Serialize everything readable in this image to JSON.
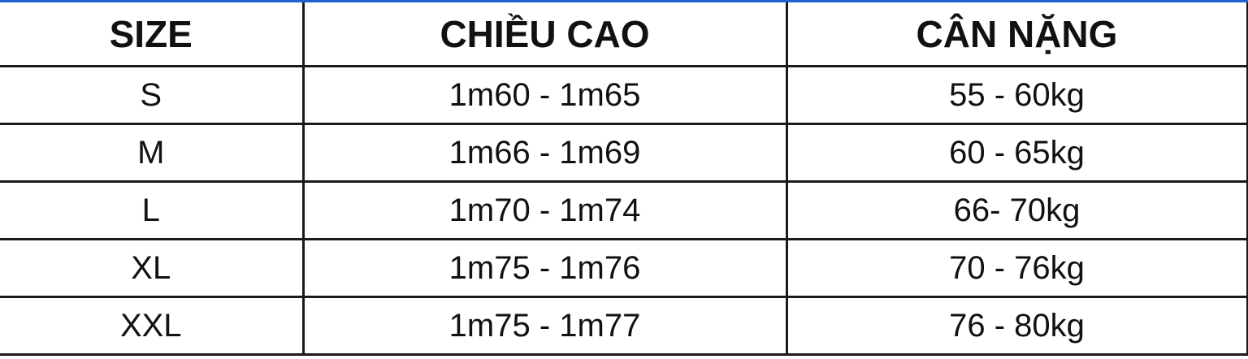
{
  "table": {
    "headers": [
      "SIZE",
      "CHIỀU CAO",
      "CÂN NẶNG"
    ],
    "rows": [
      [
        "S",
        "1m60 - 1m65",
        "55 - 60kg"
      ],
      [
        "M",
        "1m66 - 1m69",
        "60 - 65kg"
      ],
      [
        "L",
        "1m70 - 1m74",
        "66- 70kg"
      ],
      [
        "XL",
        "1m75 - 1m76",
        "70 - 76kg"
      ],
      [
        "XXL",
        "1m75 - 1m77",
        "76 - 80kg"
      ]
    ]
  },
  "colors": {
    "top_border": "#1e64c8",
    "grid": "#1a1a1a"
  }
}
